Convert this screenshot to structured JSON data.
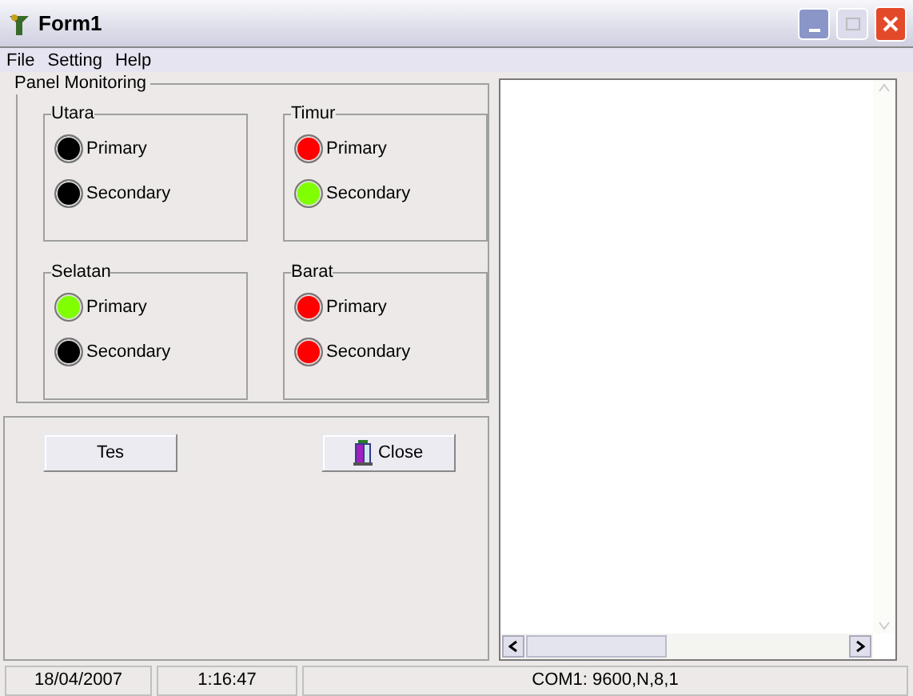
{
  "window": {
    "title": "Form1"
  },
  "menu": [
    "File",
    "Setting",
    "Help"
  ],
  "panel": {
    "title": "Panel Monitoring",
    "groups": [
      {
        "title": "Utara",
        "lamps": [
          {
            "label": "Primary",
            "color": "#000000"
          },
          {
            "label": "Secondary",
            "color": "#000000"
          }
        ]
      },
      {
        "title": "Timur",
        "lamps": [
          {
            "label": "Primary",
            "color": "#ff0000"
          },
          {
            "label": "Secondary",
            "color": "#80ff00"
          }
        ]
      },
      {
        "title": "Selatan",
        "lamps": [
          {
            "label": "Primary",
            "color": "#80ff00"
          },
          {
            "label": "Secondary",
            "color": "#000000"
          }
        ]
      },
      {
        "title": "Barat",
        "lamps": [
          {
            "label": "Primary",
            "color": "#ff0000"
          },
          {
            "label": "Secondary",
            "color": "#ff0000"
          }
        ]
      }
    ]
  },
  "buttons": [
    {
      "label": "Tes",
      "kind": "plain"
    },
    {
      "label": "Close",
      "kind": "icon"
    }
  ],
  "status_bar": [
    "18/04/2007",
    "1:16:47",
    "COM1: 9600,N,8,1"
  ]
}
